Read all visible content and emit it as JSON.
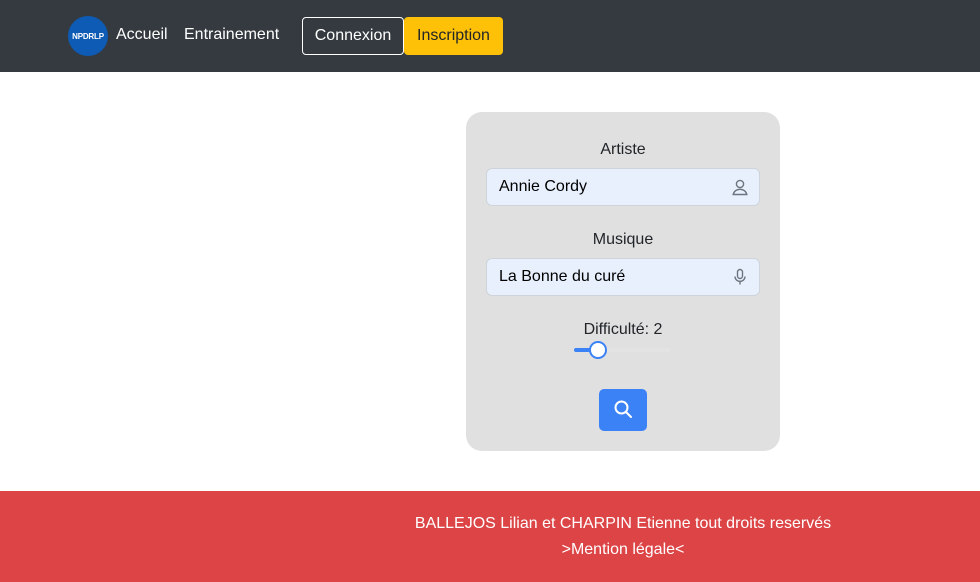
{
  "navbar": {
    "logo_text": "NPDRLP",
    "links": {
      "accueil": "Accueil",
      "entrainement": "Entrainement"
    },
    "connexion_label": "Connexion",
    "inscription_label": "Inscription"
  },
  "form": {
    "artiste": {
      "label": "Artiste",
      "value": "Annie Cordy",
      "icon": "user-icon"
    },
    "musique": {
      "label": "Musique",
      "value": "La Bonne du curé",
      "icon": "microphone-icon"
    },
    "difficulty": {
      "label": "Difficulté: 2",
      "value": 2,
      "min": 1,
      "max": 5
    },
    "search_icon": "search-icon"
  },
  "footer": {
    "credits": "BALLEJOS Lilian et CHARPIN Etienne tout droits reservés",
    "legal": ">Mention légale<"
  },
  "colors": {
    "navbar_bg": "#343a40",
    "inscription_bg": "#ffc107",
    "card_bg": "#e0e0e0",
    "accent": "#3b82f6",
    "footer_bg": "#dc4446"
  }
}
